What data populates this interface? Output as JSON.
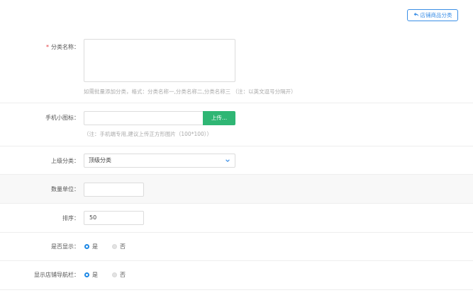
{
  "header": {
    "store_category_button": "店铺商品分类"
  },
  "form": {
    "category_name": {
      "required_mark": "*",
      "label": "分类名称：",
      "hint": "如需批量添加分类，格式：分类名称一,分类名称二,分类名称三 （注：以英文逗号分隔开）"
    },
    "mobile_icon": {
      "label": "手机小图标：",
      "upload_label": "上传...",
      "hint": "（注：手机端专用,建议上传正方形图片（100*100））"
    },
    "parent_category": {
      "label": "上级分类：",
      "selected": "顶级分类"
    },
    "quantity_unit": {
      "label": "数量单位：",
      "value": ""
    },
    "sort_order": {
      "label": "排序：",
      "value": "50"
    },
    "is_show": {
      "label": "是否显示：",
      "options": [
        {
          "label": "是",
          "selected": true
        },
        {
          "label": "否",
          "selected": false
        }
      ]
    },
    "show_in_store_nav": {
      "label": "显示店铺导航栏：",
      "options": [
        {
          "label": "是",
          "selected": true
        },
        {
          "label": "否",
          "selected": false
        }
      ]
    }
  },
  "colors": {
    "accent": "#1e88e5",
    "upload_green": "#2fb674",
    "required_red": "#e4393c"
  }
}
